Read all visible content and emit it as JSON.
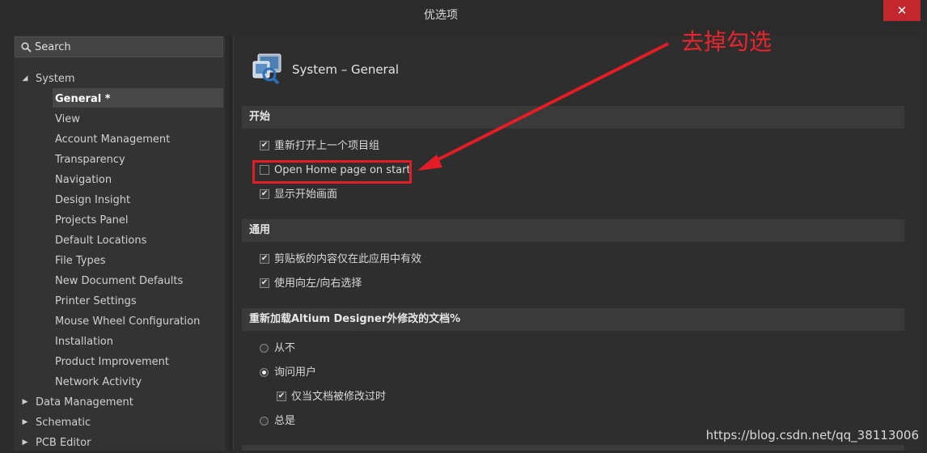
{
  "window": {
    "title": "优选项",
    "close_glyph": "✕"
  },
  "search": {
    "label": "Search"
  },
  "tree": [
    {
      "label": "System",
      "level": 0,
      "expanded": true
    },
    {
      "label": "General *",
      "level": 1,
      "selected": true
    },
    {
      "label": "View",
      "level": 1
    },
    {
      "label": "Account Management",
      "level": 1
    },
    {
      "label": "Transparency",
      "level": 1
    },
    {
      "label": "Navigation",
      "level": 1
    },
    {
      "label": "Design Insight",
      "level": 1
    },
    {
      "label": "Projects Panel",
      "level": 1
    },
    {
      "label": "Default Locations",
      "level": 1
    },
    {
      "label": "File Types",
      "level": 1
    },
    {
      "label": "New Document Defaults",
      "level": 1
    },
    {
      "label": "Printer Settings",
      "level": 1
    },
    {
      "label": "Mouse Wheel Configuration",
      "level": 1
    },
    {
      "label": "Installation",
      "level": 1
    },
    {
      "label": "Product Improvement",
      "level": 1
    },
    {
      "label": "Network Activity",
      "level": 1
    },
    {
      "label": "Data Management",
      "level": 0,
      "expanded": false
    },
    {
      "label": "Schematic",
      "level": 0,
      "expanded": false
    },
    {
      "label": "PCB Editor",
      "level": 0,
      "expanded": false
    }
  ],
  "page": {
    "title": "System – General"
  },
  "sections": {
    "start": {
      "title": "开始",
      "options": [
        {
          "label": "重新打开上一个项目组",
          "checked": true
        },
        {
          "label": "Open Home page on start",
          "checked": false
        },
        {
          "label": "显示开始画面",
          "checked": true
        }
      ]
    },
    "general": {
      "title": "通用",
      "options": [
        {
          "label": "剪贴板的内容仅在此应用中有效",
          "checked": true
        },
        {
          "label": "使用向左/向右选择",
          "checked": true
        }
      ]
    },
    "reload": {
      "title": "重新加载Altium Designer外修改的文档%",
      "options": [
        {
          "label": "从不",
          "selected": false
        },
        {
          "label": "询问用户",
          "selected": true
        },
        {
          "label": "仅当文档被修改过时",
          "checked": true
        },
        {
          "label": "总是",
          "selected": false
        }
      ]
    }
  },
  "annotation": {
    "text": "去掉勾选",
    "color": "#e21d25"
  },
  "watermark": "https://blog.csdn.net/qq_38113006"
}
